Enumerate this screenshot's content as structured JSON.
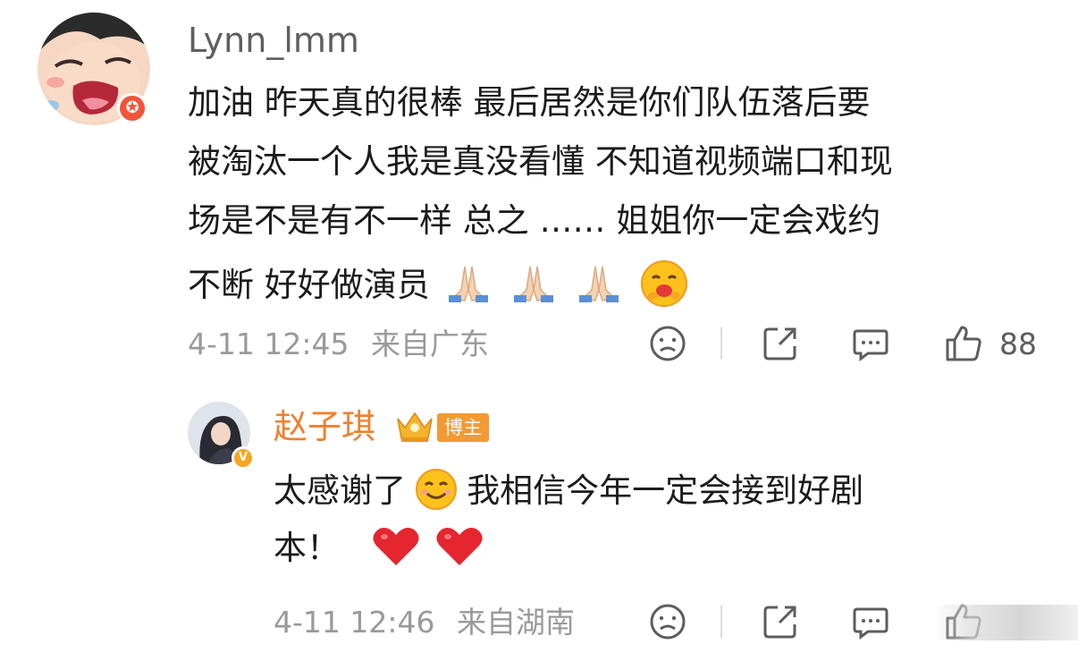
{
  "comment": {
    "username": "Lynn_lmm",
    "lines": [
      "加油 昨天真的很棒 最后居然是你们队伍落后要",
      "被淘汰一个人我是真没看懂 不知道视频端口和现",
      "场是不是有不一样 总之 ……  姐姐你一定会戏约",
      "不断 好好做演员"
    ],
    "emojis": [
      "pray-emoji",
      "pray-emoji",
      "pray-emoji",
      "hugging-face-emoji"
    ],
    "date": "4-11 12:45",
    "location": "来自广东",
    "like_count": "88",
    "icons": [
      "dislike-face-icon",
      "share-icon",
      "comment-icon",
      "like-thumb-icon"
    ]
  },
  "reply": {
    "username": "赵子琪",
    "role_badge": "博主",
    "lines": [
      "太感谢了",
      "我相信今年一定会接到好剧",
      "本！"
    ],
    "emojis": [
      "smiling-face-emoji",
      "red-heart-emoji",
      "red-heart-emoji"
    ],
    "date": "4-11 12:46",
    "location": "来自湖南",
    "icons": [
      "dislike-face-icon",
      "share-icon",
      "comment-icon",
      "like-thumb-icon"
    ]
  },
  "colors": {
    "username_gray": "#5f5f5f",
    "blogger_orange": "#f07f2c",
    "badge_orange": "#f39a34",
    "meta_gray": "#9a9a9a",
    "heart_red": "#e4262f"
  }
}
